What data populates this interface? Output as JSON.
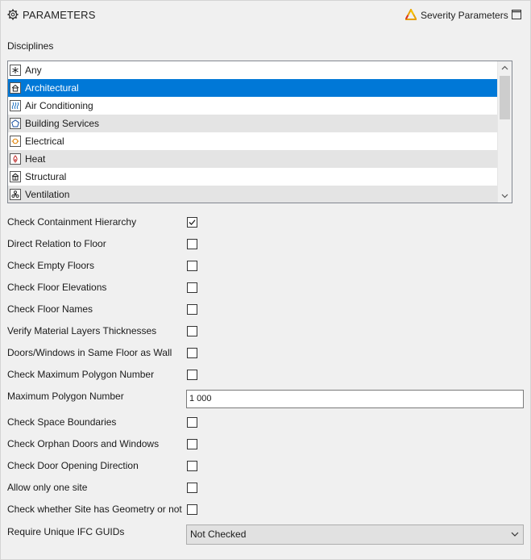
{
  "header": {
    "title": "PARAMETERS",
    "severity_label": "Severity Parameters"
  },
  "disciplines": {
    "label": "Disciplines",
    "items": [
      {
        "label": "Any",
        "icon": "asterisk-icon",
        "style": "normal"
      },
      {
        "label": "Architectural",
        "icon": "house-icon",
        "style": "selected"
      },
      {
        "label": "Air Conditioning",
        "icon": "air-conditioning-icon",
        "style": "normal"
      },
      {
        "label": "Building Services",
        "icon": "building-services-icon",
        "style": "alt"
      },
      {
        "label": "Electrical",
        "icon": "electrical-icon",
        "style": "normal"
      },
      {
        "label": "Heat",
        "icon": "heat-icon",
        "style": "alt"
      },
      {
        "label": "Structural",
        "icon": "structural-icon",
        "style": "normal"
      },
      {
        "label": "Ventilation",
        "icon": "ventilation-icon",
        "style": "alt"
      }
    ]
  },
  "params": {
    "check_containment_hierarchy": {
      "label": "Check Containment Hierarchy",
      "checked": true
    },
    "direct_relation_to_floor": {
      "label": "Direct Relation to Floor",
      "checked": false
    },
    "check_empty_floors": {
      "label": "Check Empty Floors",
      "checked": false
    },
    "check_floor_elevations": {
      "label": "Check Floor Elevations",
      "checked": false
    },
    "check_floor_names": {
      "label": "Check Floor Names",
      "checked": false
    },
    "verify_material_layers": {
      "label": "Verify Material Layers Thicknesses",
      "checked": false
    },
    "doors_windows_same_floor": {
      "label": "Doors/Windows in Same Floor as Wall",
      "checked": false
    },
    "check_max_polygon": {
      "label": "Check Maximum Polygon Number",
      "checked": false
    },
    "max_polygon_number": {
      "label": "Maximum Polygon Number",
      "value": "1 000"
    },
    "check_space_boundaries": {
      "label": "Check Space Boundaries",
      "checked": false
    },
    "check_orphan_doors": {
      "label": "Check Orphan Doors and Windows",
      "checked": false
    },
    "check_door_opening": {
      "label": "Check Door Opening Direction",
      "checked": false
    },
    "allow_one_site": {
      "label": "Allow only one site",
      "checked": false
    },
    "check_site_geometry": {
      "label": "Check whether Site has Geometry or not",
      "checked": false
    },
    "require_unique_guids": {
      "label": "Require Unique IFC GUIDs",
      "value": "Not Checked"
    }
  },
  "colors": {
    "selection": "#0078d7",
    "alt_row": "#e4e4e4",
    "background": "#f0f0f0"
  }
}
